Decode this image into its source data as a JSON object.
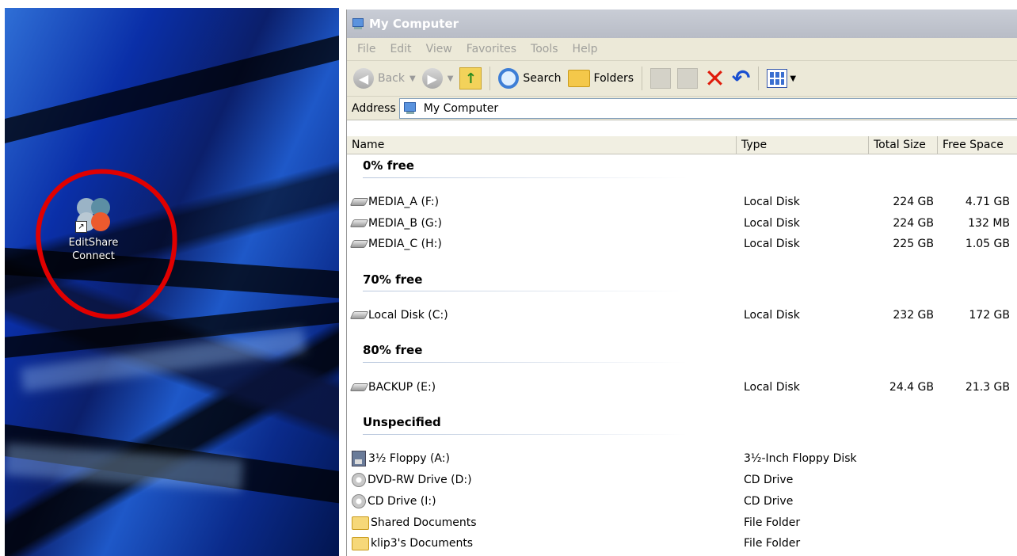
{
  "desktop": {
    "icon": {
      "label_line1": "EditShare",
      "label_line2": "Connect"
    },
    "highlight_color": "#e00000"
  },
  "window": {
    "title": "My Computer",
    "menu": [
      "File",
      "Edit",
      "View",
      "Favorites",
      "Tools",
      "Help"
    ],
    "toolbar": {
      "back": "Back",
      "search": "Search",
      "folders": "Folders"
    },
    "address": {
      "label": "Address",
      "value": "My Computer"
    },
    "columns": {
      "name": "Name",
      "type": "Type",
      "total": "Total Size",
      "free": "Free Space"
    },
    "groups": [
      {
        "title": "0% free",
        "items": [
          {
            "name": "MEDIA_A (F:)",
            "type": "Local Disk",
            "total": "224 GB",
            "free": "4.71 GB",
            "icon": "hard-disk-icon"
          },
          {
            "name": "MEDIA_B (G:)",
            "type": "Local Disk",
            "total": "224 GB",
            "free": "132 MB",
            "icon": "hard-disk-icon"
          },
          {
            "name": "MEDIA_C (H:)",
            "type": "Local Disk",
            "total": "225 GB",
            "free": "1.05 GB",
            "icon": "hard-disk-icon"
          }
        ]
      },
      {
        "title": "70% free",
        "items": [
          {
            "name": "Local Disk (C:)",
            "type": "Local Disk",
            "total": "232 GB",
            "free": "172 GB",
            "icon": "hard-disk-icon"
          }
        ]
      },
      {
        "title": "80% free",
        "items": [
          {
            "name": "BACKUP (E:)",
            "type": "Local Disk",
            "total": "24.4 GB",
            "free": "21.3 GB",
            "icon": "hard-disk-icon"
          }
        ]
      },
      {
        "title": "Unspecified",
        "items": [
          {
            "name": "3½ Floppy (A:)",
            "type": "3½-Inch Floppy Disk",
            "total": "",
            "free": "",
            "icon": "floppy-icon"
          },
          {
            "name": "DVD-RW Drive (D:)",
            "type": "CD Drive",
            "total": "",
            "free": "",
            "icon": "cd-drive-icon"
          },
          {
            "name": "CD Drive (I:)",
            "type": "CD Drive",
            "total": "",
            "free": "",
            "icon": "cd-drive-icon"
          },
          {
            "name": "Shared Documents",
            "type": "File Folder",
            "total": "",
            "free": "",
            "icon": "folder-icon"
          },
          {
            "name": "klip3's Documents",
            "type": "File Folder",
            "total": "",
            "free": "",
            "icon": "folder-icon"
          }
        ]
      }
    ]
  }
}
